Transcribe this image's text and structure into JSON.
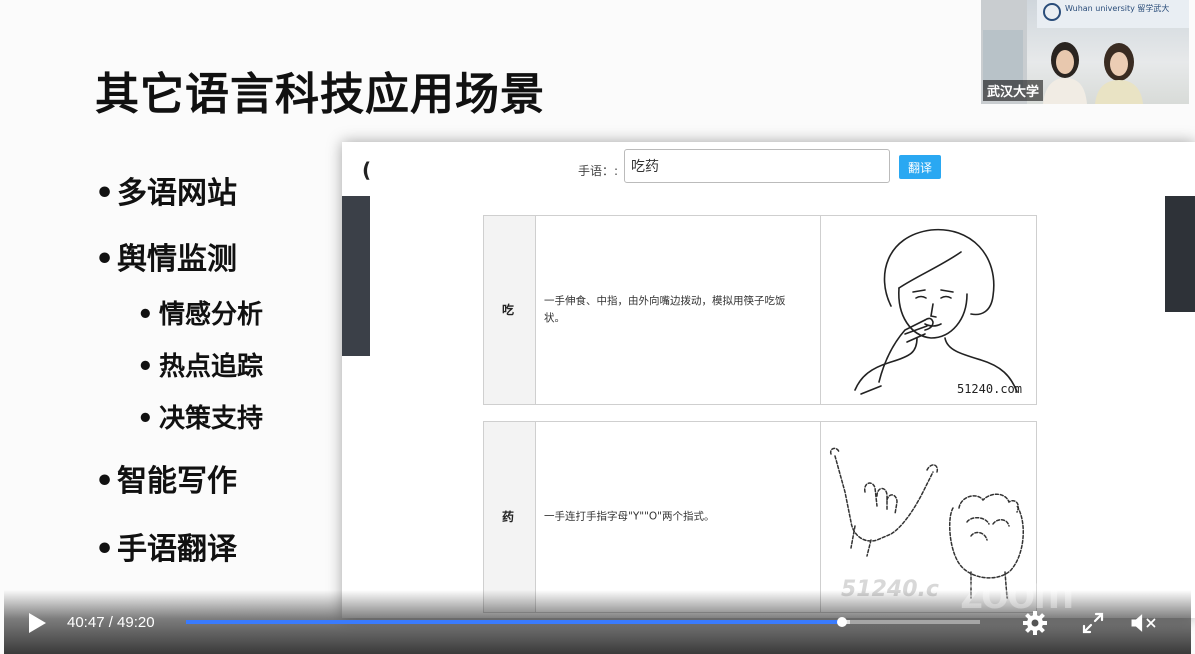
{
  "slide": {
    "title": "其它语言科技应用场景",
    "bullets": [
      {
        "text": "多语网站",
        "level": 1
      },
      {
        "text": "舆情监测",
        "level": 1
      },
      {
        "text": "情感分析",
        "level": 2
      },
      {
        "text": "热点追踪",
        "level": 2
      },
      {
        "text": "决策支持",
        "level": 2
      },
      {
        "text": "智能写作",
        "level": 1
      },
      {
        "text": "手语翻译",
        "level": 1
      }
    ]
  },
  "embedded_app": {
    "paren": "(",
    "search_label": "手语：:",
    "search_value": "吃药",
    "translate_button": "翻译",
    "rows": [
      {
        "word": "吃",
        "description": "一手伸食、中指，由外向嘴边拨动，模拟用筷子吃饭状。",
        "image_watermark": "51240.com"
      },
      {
        "word": "药",
        "description": "一手连打手指字母\"Y\"\"O\"两个指式。",
        "image_watermark": "51240.c"
      }
    ]
  },
  "webcam": {
    "name_tag": "武汉大学",
    "banner_text": "Wuhan university 留学武大"
  },
  "player": {
    "current_time": "40:47",
    "duration": "49:20",
    "time_display": "40:47 / 49:20",
    "progress_fraction": 0.8268,
    "buffered_fraction": 0.836,
    "watermark": "zoom",
    "accent_color": "#3a7bfd"
  },
  "icons": [
    "play-icon",
    "settings-gear-icon",
    "fullscreen-icon",
    "volume-muted-icon"
  ]
}
